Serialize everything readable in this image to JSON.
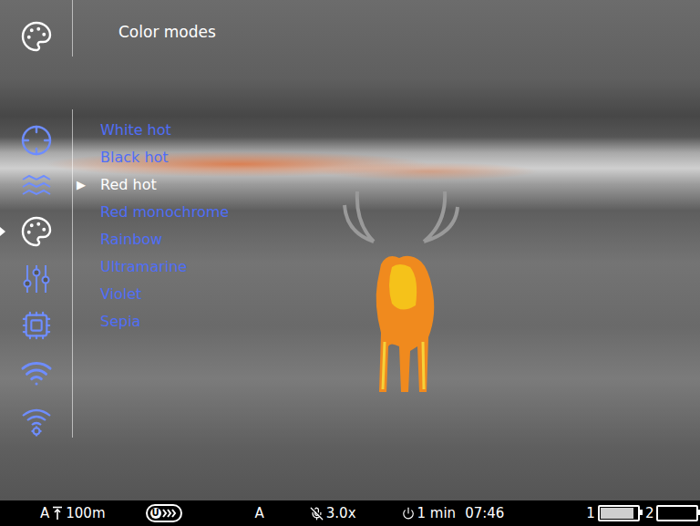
{
  "header": {
    "title": "Color modes"
  },
  "sidebar": {
    "items": [
      {
        "selected": false
      },
      {
        "selected": false
      },
      {
        "selected": true
      },
      {
        "selected": false
      },
      {
        "selected": false
      },
      {
        "selected": false
      },
      {
        "selected": false
      }
    ]
  },
  "menu": {
    "marker": "▶",
    "items": [
      {
        "label": "White hot",
        "selected": false
      },
      {
        "label": "Black hot",
        "selected": false
      },
      {
        "label": "Red hot",
        "selected": true
      },
      {
        "label": "Red monochrome",
        "selected": false
      },
      {
        "label": "Rainbow",
        "selected": false
      },
      {
        "label": "Ultramarine",
        "selected": false
      },
      {
        "label": "Violet",
        "selected": false
      },
      {
        "label": "Sepia",
        "selected": false
      }
    ]
  },
  "status_bar": {
    "range_mode": "A",
    "range": "100m",
    "stream_badge": "U",
    "mode": "A",
    "zoom": "3.0x",
    "timer": "1 min",
    "clock": "07:46",
    "batteries": [
      {
        "label": "1",
        "level": 0.9
      },
      {
        "label": "2",
        "level": 0
      }
    ]
  }
}
